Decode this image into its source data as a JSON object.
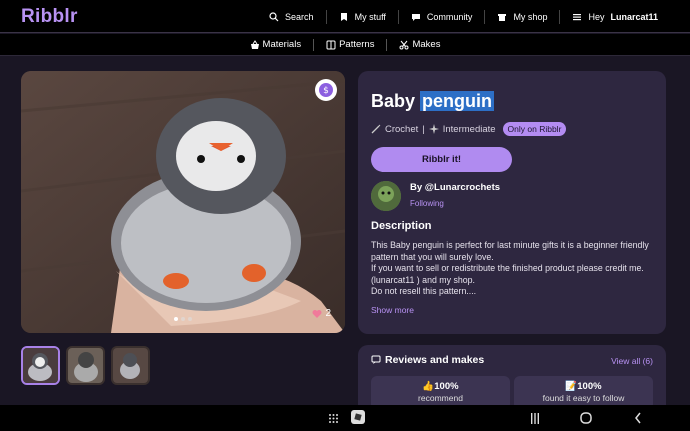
{
  "app": {
    "logo": "Ribblr"
  },
  "nav": {
    "search": "Search",
    "mystuff": "My stuff",
    "community": "Community",
    "myshop": "My shop",
    "greeting": "Hey",
    "username": "Lunarcat11"
  },
  "subnav": {
    "materials": "Materials",
    "patterns": "Patterns",
    "makes": "Makes"
  },
  "gallery": {
    "likes": "2"
  },
  "pattern": {
    "title_prefix": "Baby",
    "title_highlight": "penguin",
    "craft": "Crochet",
    "level": "Intermediate",
    "exclusive": "Only on Ribblr",
    "cta": "Ribblr it!",
    "author": "By @Lunarcrochets",
    "follow_status": "Following",
    "description_heading": "Description",
    "description": [
      "This Baby penguin is perfect for last minute gifts it is a beginner friendly pattern that you will surely love.",
      "If you want to sell or redistribute the finished product please credit me. (lunarcat11 ) and my shop.",
      "Do not resell this pattern...."
    ],
    "show_more": "Show more"
  },
  "reviews": {
    "heading": "Reviews and makes",
    "view_all": "View all (6)",
    "cards": [
      {
        "emoji": "👍",
        "value": "100%",
        "label": "recommend"
      },
      {
        "emoji": "📝",
        "value": "100%",
        "label": "found it easy to follow"
      }
    ]
  },
  "colors": {
    "accent": "#b08bf0",
    "background": "#1a1624",
    "panel": "#2e2740",
    "highlight": "#2d6fc6"
  }
}
